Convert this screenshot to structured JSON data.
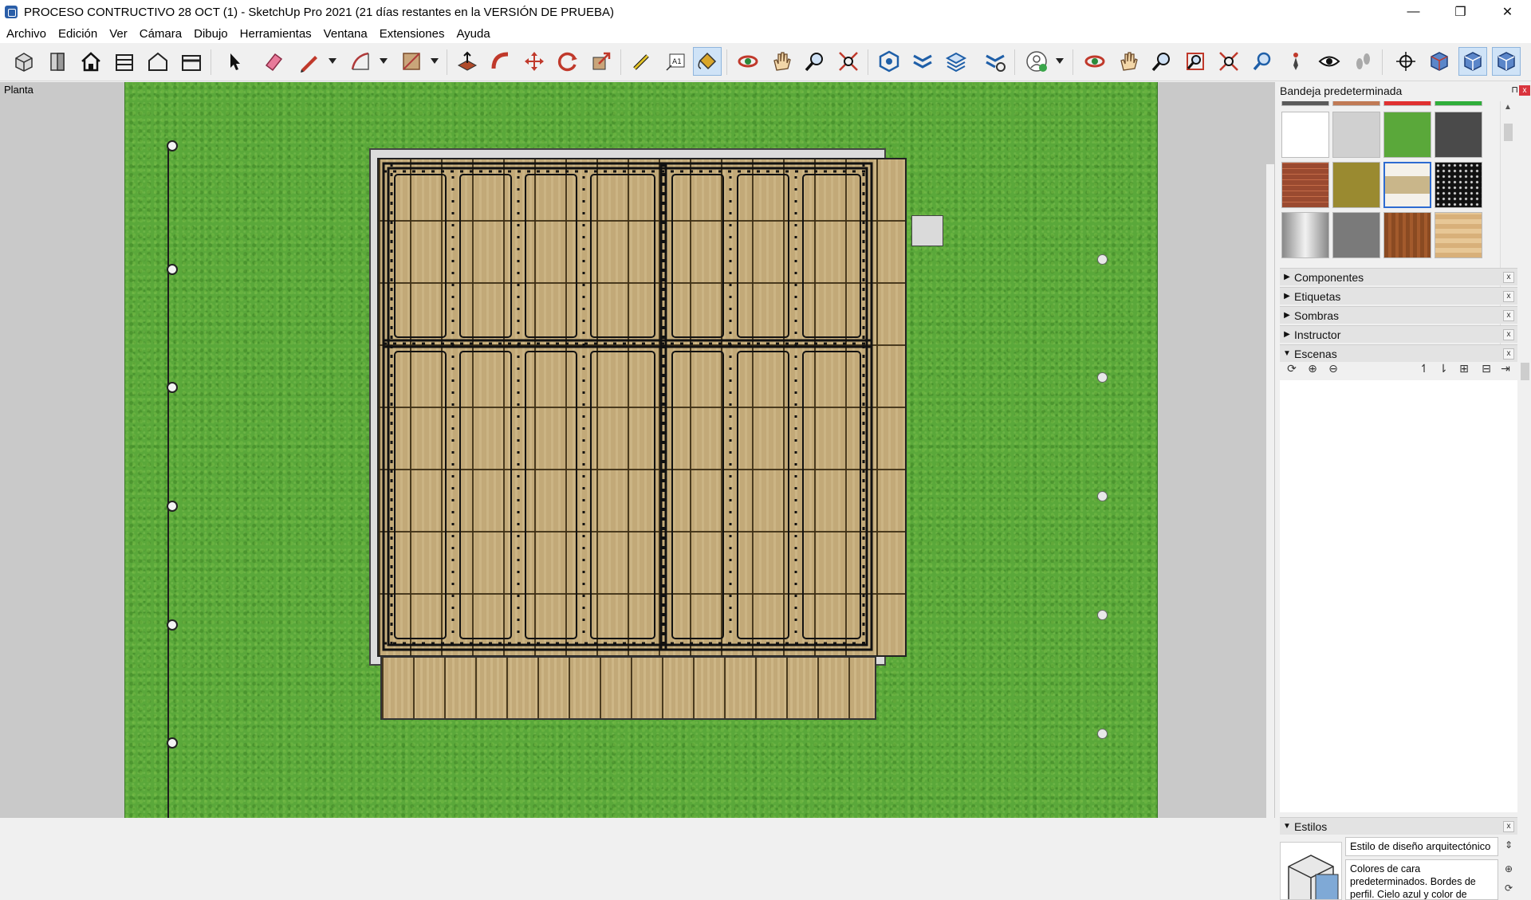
{
  "window": {
    "title": "PROCESO CONTRUCTIVO 28 OCT (1) - SketchUp Pro 2021 (21 días restantes en la VERSIÓN DE PRUEBA)",
    "minimize": "—",
    "restore": "❐",
    "close": "✕"
  },
  "menu": [
    "Archivo",
    "Edición",
    "Ver",
    "Cámara",
    "Dibujo",
    "Herramientas",
    "Ventana",
    "Extensiones",
    "Ayuda"
  ],
  "toolbar": {
    "tools": [
      "views-iso-icon",
      "views-front-icon",
      "home-icon",
      "warehouse-icon",
      "house-outline-icon",
      "extension-warehouse-icon",
      "select-icon",
      "eraser-icon",
      "pencil-icon",
      "shape-icon",
      "paint-area-icon",
      "push-pull-icon",
      "follow-me-icon",
      "move-icon",
      "rotate-icon",
      "scale-icon",
      "tape-measure-icon",
      "text-icon",
      "paint-bucket-icon",
      "orbit-icon",
      "pan-icon",
      "zoom-icon",
      "zoom-extents-icon",
      "solid-tools-icon",
      "section-plane-icon",
      "layers-icon",
      "model-settings-icon",
      "account-icon",
      "orbit2-icon",
      "pan2-icon",
      "zoom2-icon",
      "zoom-window-icon",
      "zoom-extents2-icon",
      "previous-view-icon",
      "position-camera-icon",
      "look-around-icon",
      "walk-icon",
      "position-icon",
      "display-icon",
      "style-xray-icon",
      "style-back-edges-icon"
    ],
    "active_tool": "paint-bucket-icon"
  },
  "viewport": {
    "scene_label": "Planta"
  },
  "tray": {
    "title": "Bandeja predeterminada",
    "pin": "⊓",
    "close": "x",
    "panels": [
      {
        "label": "Componentes",
        "expanded": false
      },
      {
        "label": "Etiquetas",
        "expanded": false
      },
      {
        "label": "Sombras",
        "expanded": false
      },
      {
        "label": "Instructor",
        "expanded": false
      },
      {
        "label": "Escenas",
        "expanded": true
      }
    ],
    "styles_panel": {
      "label": "Estilos",
      "style_name": "Estilo de diseño arquitectónico",
      "description": "Colores de cara predeterminados. Bordes de perfil. Cielo azul y color de"
    }
  },
  "colors": {
    "accent_active": "#cfe3f7",
    "grass": "#5aa83a",
    "tray_close": "#d9343d"
  }
}
